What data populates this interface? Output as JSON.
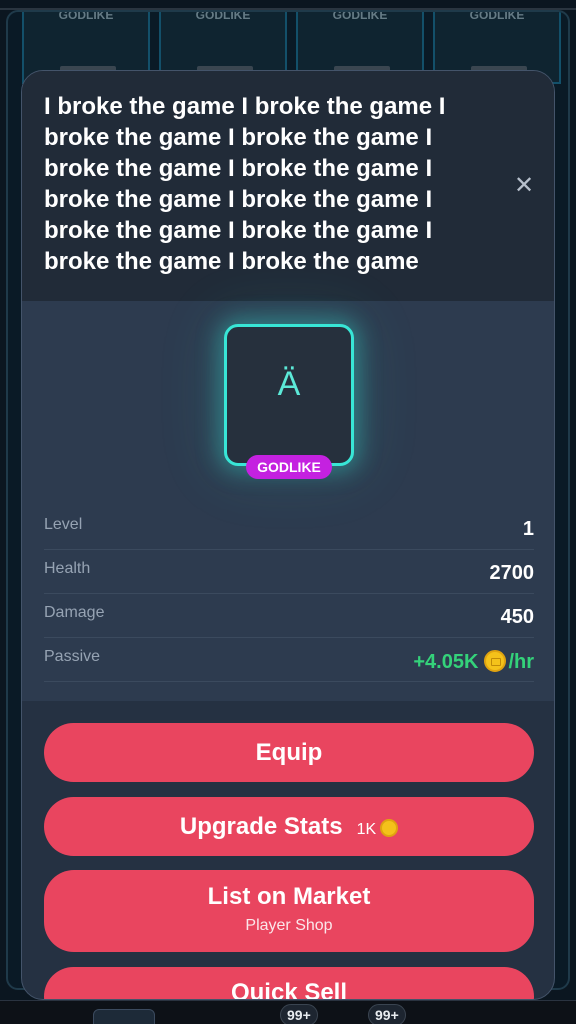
{
  "background": {
    "card_labels": [
      "GODLIKE",
      "GODLIKE",
      "GODLIKE",
      "GODLIKE"
    ]
  },
  "modal": {
    "title": "I broke the game I broke the game I broke the game I broke the game I broke the game I broke the game I broke the game I broke the game I broke the game I broke the game I broke the game I broke the game",
    "close_label": "✕",
    "item_glyph": "Ä",
    "rarity": "GODLIKE",
    "stats": [
      {
        "label": "Level",
        "value": "1"
      },
      {
        "label": "Health",
        "value": "2700"
      },
      {
        "label": "Damage",
        "value": "450"
      },
      {
        "label": "Passive",
        "value": "+4.05K",
        "unit": "/hr"
      }
    ],
    "buttons": {
      "equip": "Equip",
      "upgrade": "Upgrade Stats",
      "upgrade_price": "1K",
      "list_market": "List on Market",
      "list_market_sub": "Player Shop",
      "quick_sell": "Quick Sell"
    }
  },
  "bottom_nav": {
    "badge_1": "99+",
    "badge_2": "99+"
  },
  "colors": {
    "accent": "#e9455f",
    "glow": "#38e6d6",
    "rarity_badge": "#c421e0",
    "positive": "#34d27a"
  }
}
